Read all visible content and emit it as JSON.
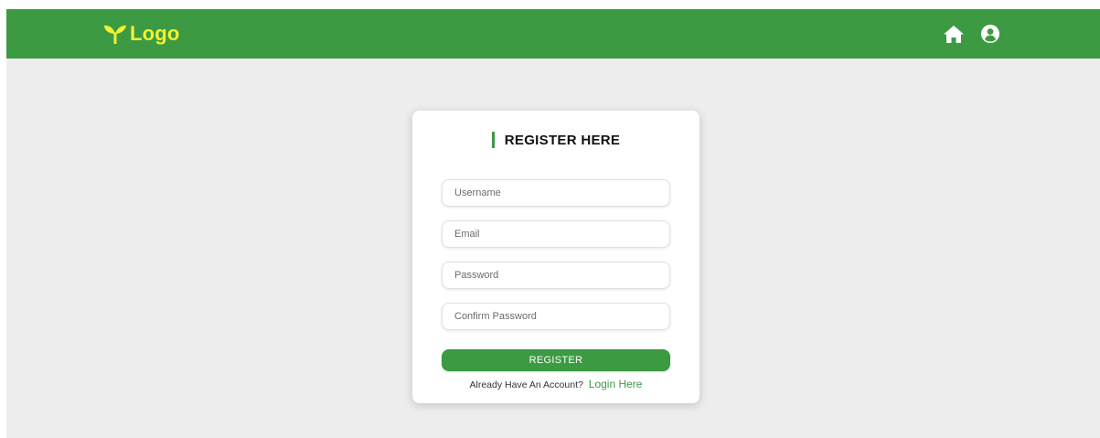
{
  "colors": {
    "navbar_bg": "#3c9a43",
    "logo": "#f2f230",
    "page_bg": "#ededed",
    "accent": "#3c9a43"
  },
  "navbar": {
    "brand_icon": "sprout-icon",
    "brand_text": "Logo",
    "icons": [
      "home-icon",
      "user-circle-icon"
    ]
  },
  "register_card": {
    "title": "REGISTER HERE",
    "fields": {
      "username": {
        "placeholder": "Username",
        "value": ""
      },
      "email": {
        "placeholder": "Email",
        "value": ""
      },
      "password": {
        "placeholder": "Password",
        "value": ""
      },
      "confirm_password": {
        "placeholder": "Confirm Password",
        "value": ""
      }
    },
    "submit_label": "REGISTER",
    "login_prompt": "Already Have An Account?",
    "login_link": "Login Here"
  }
}
